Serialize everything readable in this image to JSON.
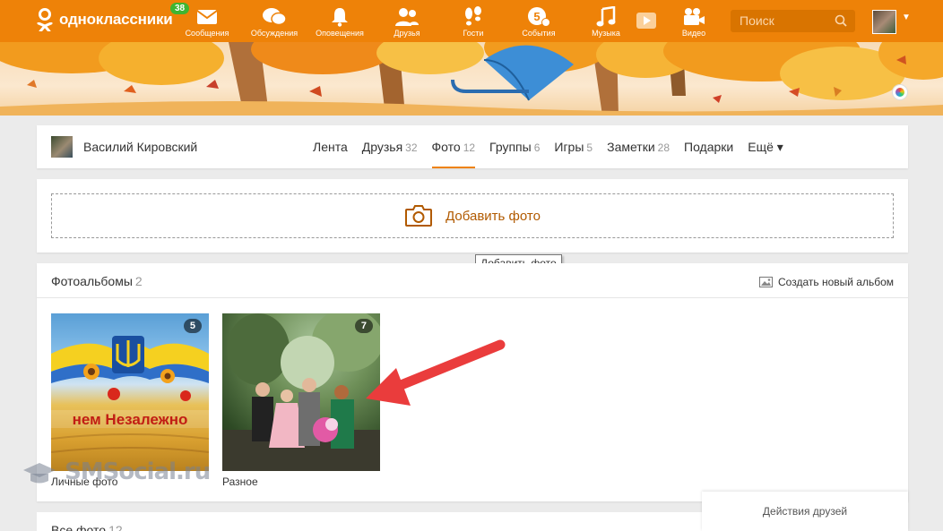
{
  "header": {
    "logo_text": "одноклассники",
    "messages_badge": "38",
    "nav": [
      {
        "label": "Сообщения",
        "icon": "envelope-icon"
      },
      {
        "label": "Обсуждения",
        "icon": "chat-bubbles-icon"
      },
      {
        "label": "Оповещения",
        "icon": "bell-icon"
      },
      {
        "label": "Друзья",
        "icon": "people-icon"
      },
      {
        "label": "Гости",
        "icon": "footprints-icon"
      },
      {
        "label": "События",
        "icon": "events-icon"
      },
      {
        "label": "Музыка",
        "icon": "music-note-icon"
      },
      {
        "label": "Видео",
        "icon": "video-camera-icon"
      }
    ],
    "search_placeholder": "Поиск"
  },
  "profile": {
    "name": "Василий Кировский",
    "tabs": [
      {
        "label": "Лента",
        "count": ""
      },
      {
        "label": "Друзья",
        "count": "32"
      },
      {
        "label": "Фото",
        "count": "12"
      },
      {
        "label": "Группы",
        "count": "6"
      },
      {
        "label": "Игры",
        "count": "5"
      },
      {
        "label": "Заметки",
        "count": "28"
      },
      {
        "label": "Подарки",
        "count": ""
      },
      {
        "label": "Ещё ▾",
        "count": ""
      }
    ],
    "active_tab": "Фото"
  },
  "add_photo": {
    "label": "Добавить фото",
    "tooltip": "Добавить фото"
  },
  "albums": {
    "title": "Фотоальбомы",
    "count": "2",
    "create_label": "Создать новый альбом",
    "items": [
      {
        "name": "Личные фото",
        "count": "5",
        "caption": "нем Незалежно"
      },
      {
        "name": "Разное",
        "count": "7"
      }
    ]
  },
  "all_photos": {
    "title": "Все фото",
    "count": "12"
  },
  "friends_actions": "Действия друзей",
  "watermark": "SMSocial.ru",
  "colors": {
    "brand": "#ee8208",
    "accent_text": "#b15a00",
    "badge": "#3fb531"
  }
}
